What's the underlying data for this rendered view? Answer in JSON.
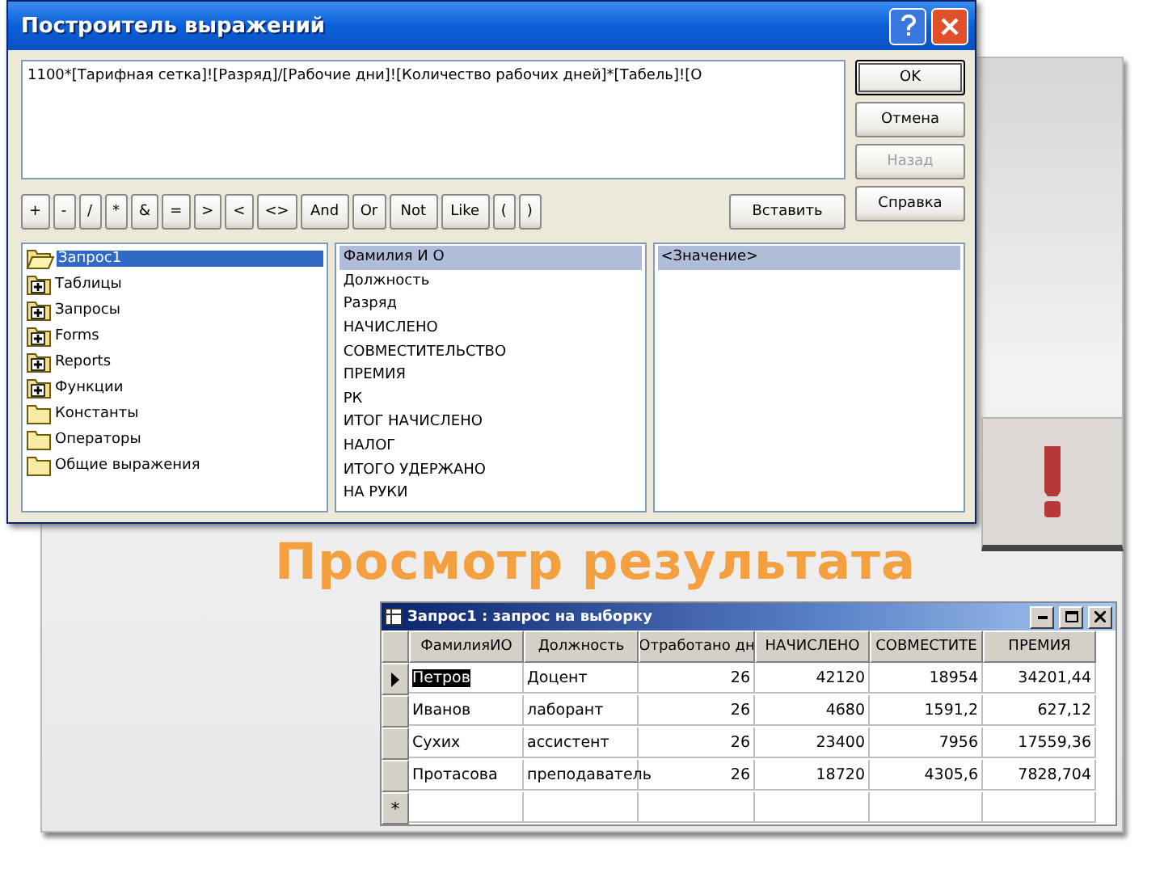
{
  "dialog": {
    "title": "Построитель выражений",
    "expression": "1100*[Тарифная сетка]![Разряд]/[Рабочие дни]![Количество рабочих дней]*[Табель]![О",
    "buttons": [
      {
        "label": "OK",
        "disabled": false,
        "default": true
      },
      {
        "label": "Отмена",
        "disabled": false,
        "default": false
      },
      {
        "label": "Назад",
        "disabled": true,
        "default": false
      },
      {
        "label": "Справка",
        "disabled": false,
        "default": false
      }
    ],
    "operators": [
      "+",
      "-",
      "/",
      "*",
      "&",
      "=",
      ">",
      "<",
      "<>",
      "And",
      "Or",
      "Not",
      "Like",
      "(",
      ")"
    ],
    "paste_button": "Вставить",
    "tree": [
      {
        "label": "Запрос1",
        "kind": "open",
        "selected": true
      },
      {
        "label": "Таблицы",
        "kind": "plus",
        "selected": false
      },
      {
        "label": "Запросы",
        "kind": "plus",
        "selected": false
      },
      {
        "label": "Forms",
        "kind": "plus",
        "selected": false
      },
      {
        "label": "Reports",
        "kind": "plus",
        "selected": false
      },
      {
        "label": "Функции",
        "kind": "plus",
        "selected": false
      },
      {
        "label": "Константы",
        "kind": "folder",
        "selected": false
      },
      {
        "label": "Операторы",
        "kind": "folder",
        "selected": false
      },
      {
        "label": "Общие выражения",
        "kind": "folder",
        "selected": false
      }
    ],
    "fields": [
      {
        "label": "Фамилия И О",
        "selected": true
      },
      {
        "label": "Должность",
        "selected": false
      },
      {
        "label": "Разряд",
        "selected": false
      },
      {
        "label": "НАЧИСЛЕНО",
        "selected": false
      },
      {
        "label": "СОВМЕСТИТЕЛЬСТВО",
        "selected": false
      },
      {
        "label": "ПРЕМИЯ",
        "selected": false
      },
      {
        "label": "РК",
        "selected": false
      },
      {
        "label": "ИТОГ НАЧИСЛЕНО",
        "selected": false
      },
      {
        "label": "НАЛОГ",
        "selected": false
      },
      {
        "label": "ИТОГО УДЕРЖАНО",
        "selected": false
      },
      {
        "label": "НА РУКИ",
        "selected": false
      }
    ],
    "values": [
      {
        "label": "<Значение>",
        "selected": true
      }
    ]
  },
  "slide_title": "Просмотр результата",
  "datasheet": {
    "title": "Запрос1 : запрос на выборку",
    "columns": [
      {
        "label": "ФамилияИО",
        "kind": "text"
      },
      {
        "label": "Должность",
        "kind": "text"
      },
      {
        "label": "Отработано дн",
        "kind": "number"
      },
      {
        "label": "НАЧИСЛЕНО",
        "kind": "number"
      },
      {
        "label": "СОВМЕСТИТЕ",
        "kind": "number"
      },
      {
        "label": "ПРЕМИЯ",
        "kind": "number"
      }
    ],
    "rows": [
      {
        "current": true,
        "cells": [
          "Петров",
          "Доцент",
          "26",
          "42120",
          "18954",
          "34201,44"
        ]
      },
      {
        "current": false,
        "cells": [
          "Иванов",
          "лаборант",
          "26",
          "4680",
          "1591,2",
          "627,12"
        ]
      },
      {
        "current": false,
        "cells": [
          "Сухих",
          "ассистент",
          "26",
          "23400",
          "7956",
          "17559,36"
        ]
      },
      {
        "current": false,
        "cells": [
          "Протасова",
          "преподаватель",
          "26",
          "18720",
          "4305,6",
          "7828,704"
        ]
      }
    ],
    "new_row_marker": "*"
  }
}
